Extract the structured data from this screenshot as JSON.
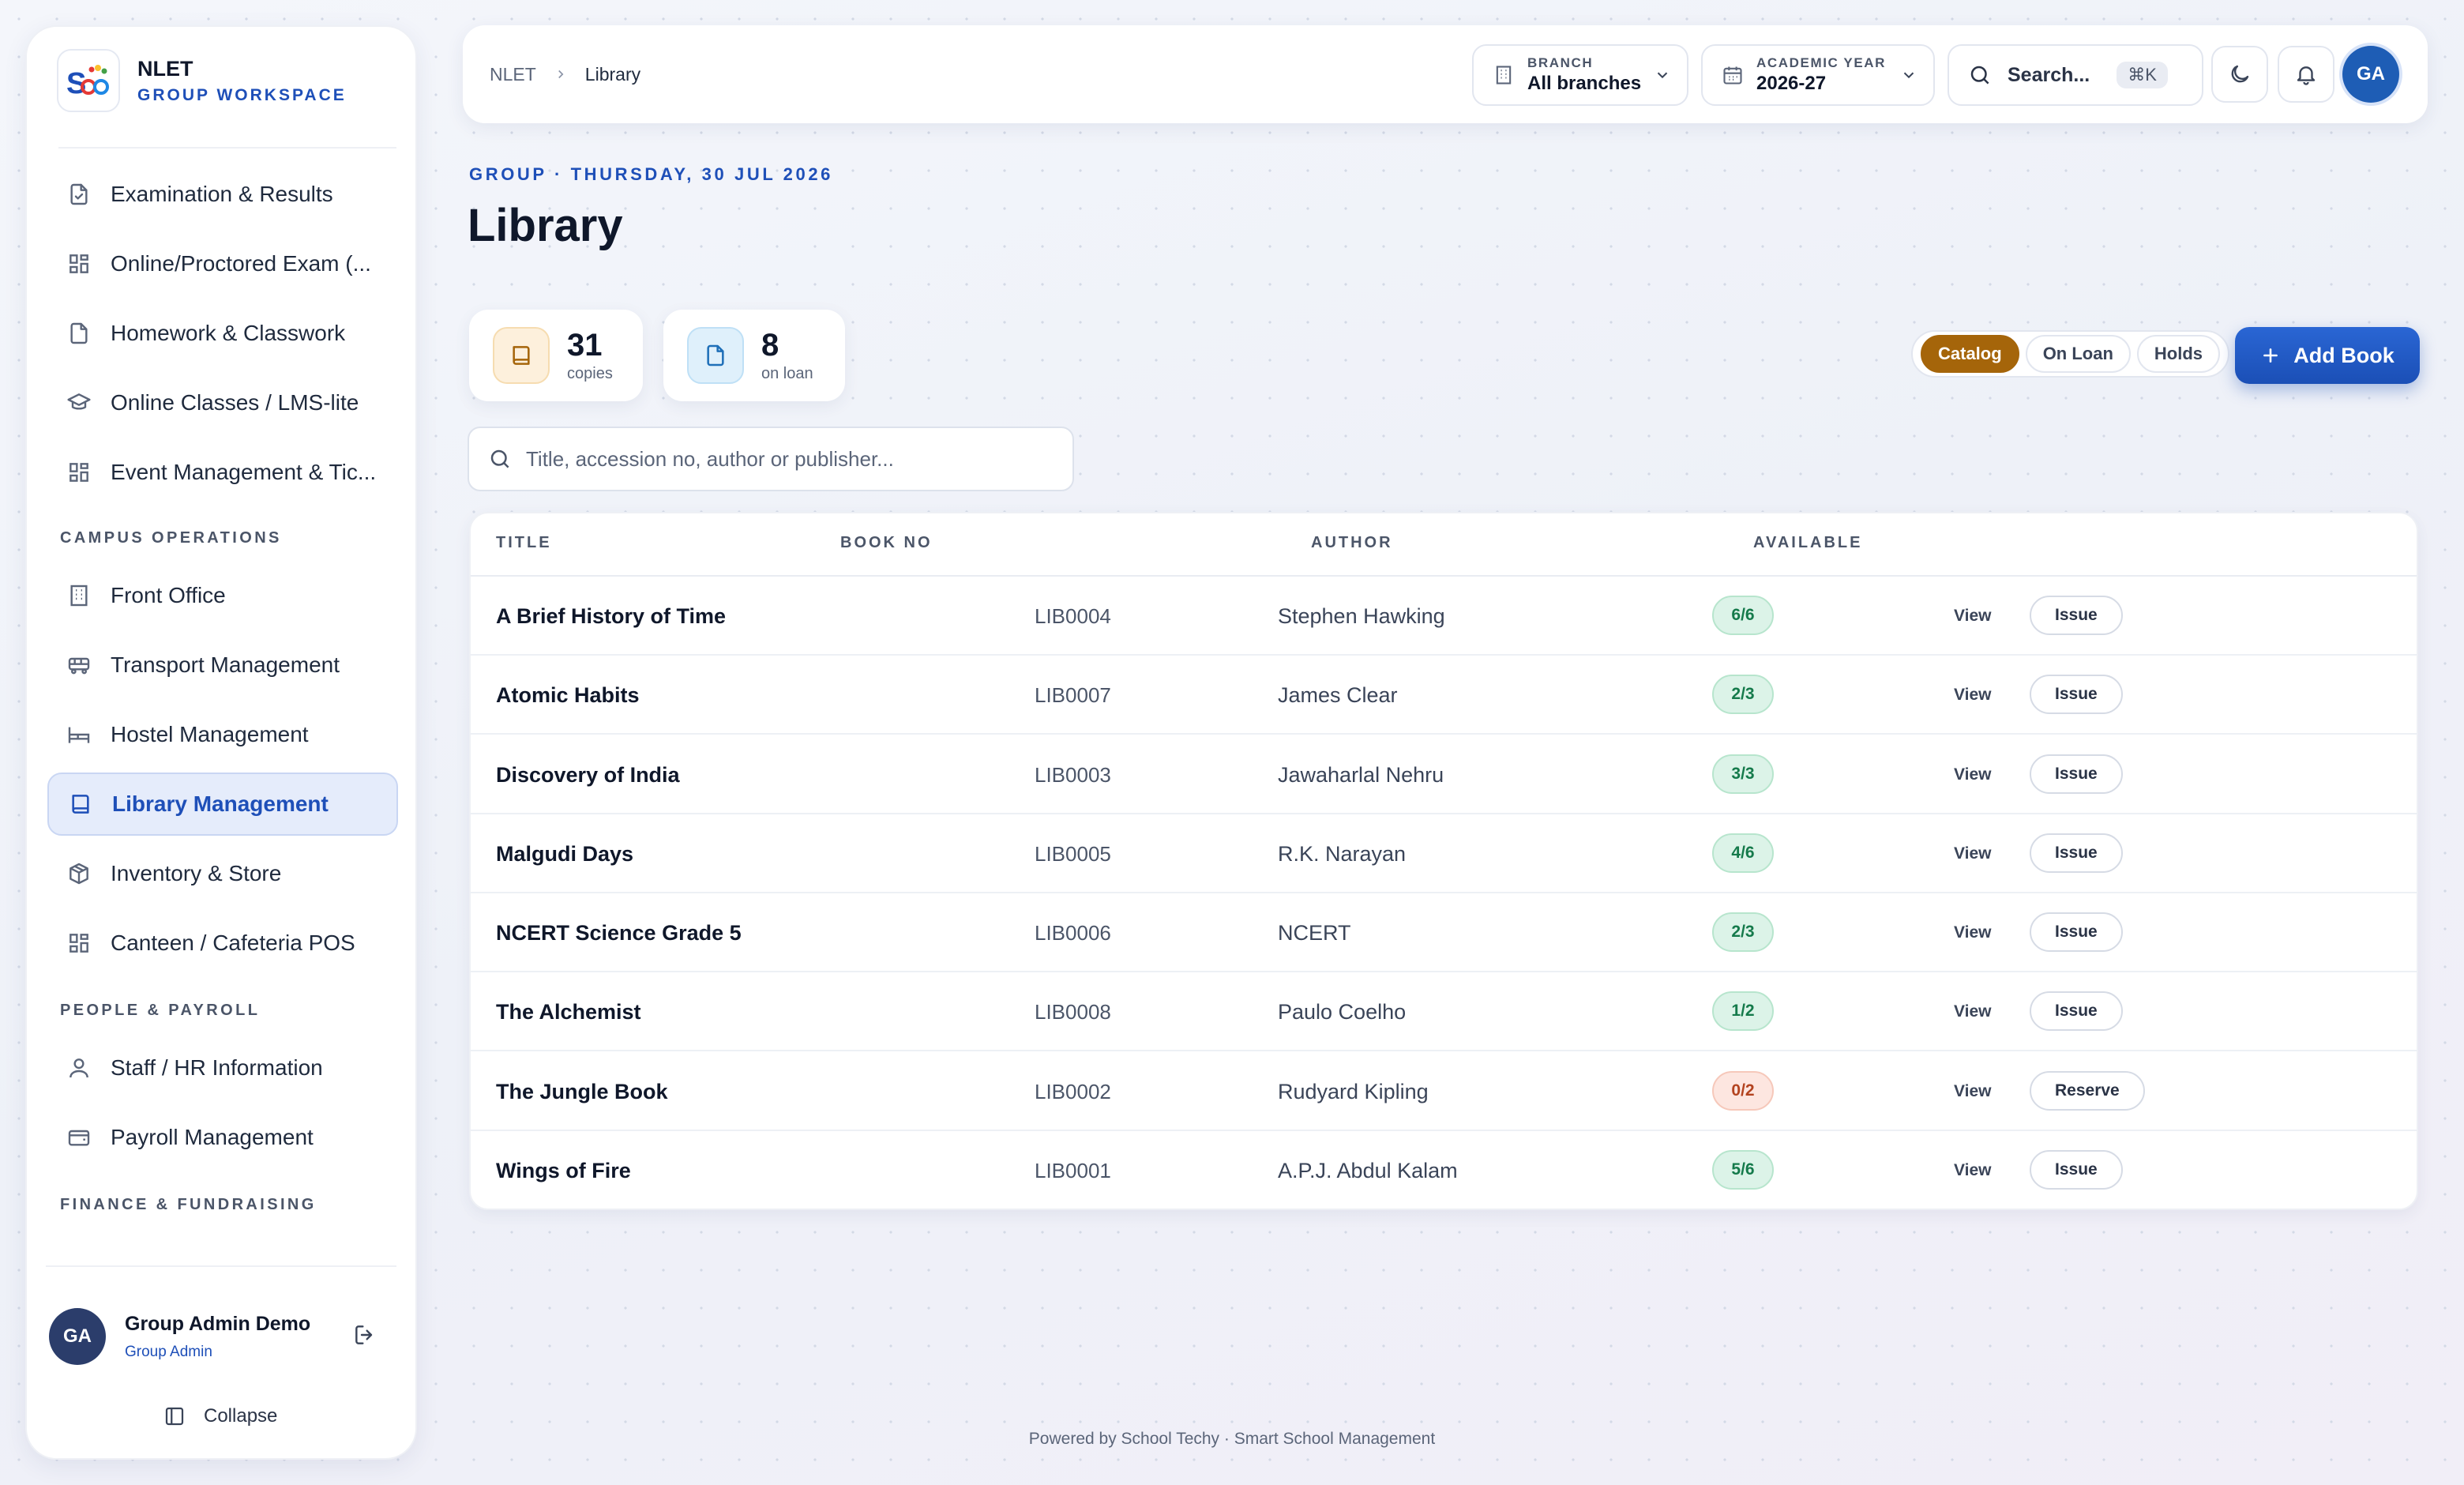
{
  "brand": {
    "name": "NLET",
    "subtitle": "GROUP WORKSPACE"
  },
  "sidebar": {
    "items": [
      {
        "label": "Examination & Results",
        "icon": "file-check-icon"
      },
      {
        "label": "Online/Proctored Exam (...",
        "icon": "grid-icon"
      },
      {
        "label": "Homework & Classwork",
        "icon": "file-icon"
      },
      {
        "label": "Online Classes / LMS-lite",
        "icon": "graduation-cap-icon"
      },
      {
        "label": "Event Management & Tic...",
        "icon": "grid-icon"
      }
    ],
    "sections": [
      {
        "title": "CAMPUS OPERATIONS",
        "items": [
          {
            "label": "Front Office",
            "icon": "building-icon"
          },
          {
            "label": "Transport Management",
            "icon": "bus-icon"
          },
          {
            "label": "Hostel Management",
            "icon": "bed-icon"
          },
          {
            "label": "Library Management",
            "icon": "book-icon",
            "active": true
          },
          {
            "label": "Inventory & Store",
            "icon": "package-icon"
          },
          {
            "label": "Canteen / Cafeteria POS",
            "icon": "grid-icon"
          }
        ]
      },
      {
        "title": "PEOPLE & PAYROLL",
        "items": [
          {
            "label": "Staff / HR Information",
            "icon": "user-icon"
          },
          {
            "label": "Payroll Management",
            "icon": "wallet-icon"
          }
        ]
      },
      {
        "title": "FINANCE & FUNDRAISING",
        "items": []
      }
    ],
    "user": {
      "initials": "GA",
      "name": "Group Admin Demo",
      "role": "Group Admin"
    },
    "collapse_label": "Collapse"
  },
  "topbar": {
    "breadcrumb": [
      "NLET",
      "Library"
    ],
    "branch": {
      "label": "BRANCH",
      "value": "All branches"
    },
    "academic_year": {
      "label": "ACADEMIC YEAR",
      "value": "2026-27"
    },
    "search": {
      "placeholder": "Search...",
      "shortcut": "⌘K"
    },
    "avatar_initials": "GA"
  },
  "page": {
    "date_line": "GROUP · THURSDAY, 30 JUL 2026",
    "title": "Library",
    "stats": [
      {
        "value": "31",
        "label": "copies",
        "icon": "book-icon",
        "color": "#a5650a"
      },
      {
        "value": "8",
        "label": "on loan",
        "icon": "file-icon",
        "color": "#1e6fb8"
      }
    ],
    "tabs": [
      {
        "label": "Catalog",
        "active": true
      },
      {
        "label": "On Loan",
        "active": false
      },
      {
        "label": "Holds",
        "active": false
      }
    ],
    "add_button": "Add Book",
    "search_placeholder": "Title, accession no, author or publisher..."
  },
  "table": {
    "headers": [
      "TITLE",
      "BOOK NO",
      "AUTHOR",
      "AVAILABLE"
    ],
    "rows": [
      {
        "title": "A Brief History of Time",
        "book_no": "LIB0004",
        "author": "Stephen Hawking",
        "available": "6/6",
        "view": "View",
        "action": "Issue"
      },
      {
        "title": "Atomic Habits",
        "book_no": "LIB0007",
        "author": "James Clear",
        "available": "2/3",
        "view": "View",
        "action": "Issue"
      },
      {
        "title": "Discovery of India",
        "book_no": "LIB0003",
        "author": "Jawaharlal Nehru",
        "available": "3/3",
        "view": "View",
        "action": "Issue"
      },
      {
        "title": "Malgudi Days",
        "book_no": "LIB0005",
        "author": "R.K. Narayan",
        "available": "4/6",
        "view": "View",
        "action": "Issue"
      },
      {
        "title": "NCERT Science Grade 5",
        "book_no": "LIB0006",
        "author": "NCERT",
        "available": "2/3",
        "view": "View",
        "action": "Issue"
      },
      {
        "title": "The Alchemist",
        "book_no": "LIB0008",
        "author": "Paulo Coelho",
        "available": "1/2",
        "view": "View",
        "action": "Issue"
      },
      {
        "title": "The Jungle Book",
        "book_no": "LIB0002",
        "author": "Rudyard Kipling",
        "available": "0/2",
        "view": "View",
        "action": "Reserve"
      },
      {
        "title": "Wings of Fire",
        "book_no": "LIB0001",
        "author": "A.P.J. Abdul Kalam",
        "available": "5/6",
        "view": "View",
        "action": "Issue"
      }
    ]
  },
  "footer": "Powered by School Techy · Smart School Management",
  "colors": {
    "accent": "#1e4fb8",
    "catalog_tab": "#a5650a",
    "available_ok": "#157a4b",
    "available_none": "#b3431f"
  }
}
